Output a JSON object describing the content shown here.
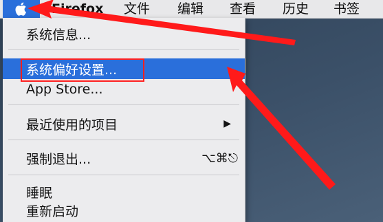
{
  "menubar": {
    "apple_icon": "apple-logo-icon",
    "app_name": "Firefox",
    "items": [
      "文件",
      "编辑",
      "查看",
      "历史",
      "书签"
    ]
  },
  "apple_menu": {
    "items": [
      {
        "label": "系统信息..."
      },
      {
        "label": "系统偏好设置...",
        "highlighted": true
      },
      {
        "label": "App Store..."
      },
      {
        "label": "最近使用的项目",
        "submenu": true
      },
      {
        "label": "强制退出...",
        "shortcut": "⌥⌘⎋"
      },
      {
        "label": "睡眠"
      },
      {
        "label": "重新启动"
      }
    ]
  },
  "colors": {
    "highlight": "#2a6fdb",
    "annotation": "#ff2020"
  }
}
